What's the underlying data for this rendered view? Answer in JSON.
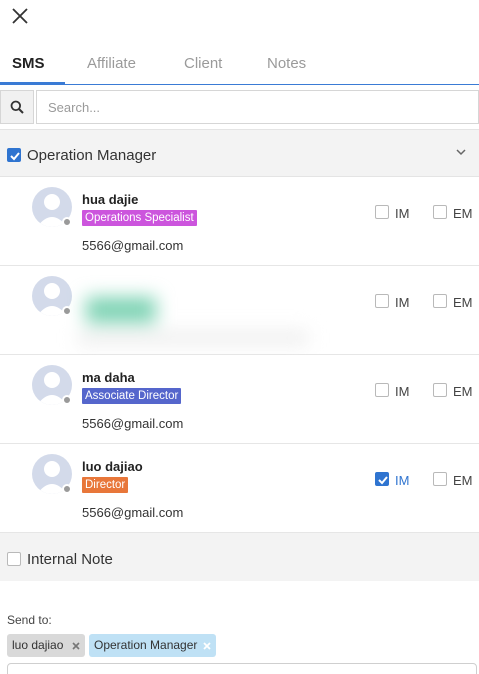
{
  "tabs": [
    {
      "label": "SMS",
      "active": true
    },
    {
      "label": "Affiliate",
      "active": false
    },
    {
      "label": "Client",
      "active": false
    },
    {
      "label": "Notes",
      "active": false
    }
  ],
  "search": {
    "placeholder": "Search..."
  },
  "group": {
    "label": "Operation Manager",
    "checked": true
  },
  "option_labels": {
    "im": "IM",
    "em": "EM"
  },
  "contacts": [
    {
      "name": "hua dajie",
      "role": "Operations Specialist",
      "role_color": "#cc55dd",
      "email": "5566@gmail.com",
      "im": false,
      "em": false,
      "blurred": false
    },
    {
      "name": "",
      "role": "",
      "role_color": "",
      "email": "",
      "im": false,
      "em": false,
      "blurred": true
    },
    {
      "name": "ma daha",
      "role": "Associate Director",
      "role_color": "#5566cc",
      "email": "5566@gmail.com",
      "im": false,
      "em": false,
      "blurred": false
    },
    {
      "name": "luo dajiao",
      "role": "Director",
      "role_color": "#e8773a",
      "email": "5566@gmail.com",
      "im": true,
      "em": false,
      "blurred": false
    }
  ],
  "internal_note": {
    "label": "Internal Note",
    "checked": false
  },
  "send_to": {
    "label": "Send to:",
    "chips": [
      {
        "label": "luo dajiao",
        "bg": "#d9d9d9"
      },
      {
        "label": "Operation Manager",
        "bg": "#bfe1f5"
      }
    ]
  },
  "colors": {
    "accent": "#2f74d0"
  },
  "icons": {
    "close": "close-icon",
    "search": "search-icon",
    "chevron": "chevron-down-icon",
    "avatar": "user-avatar-icon"
  }
}
